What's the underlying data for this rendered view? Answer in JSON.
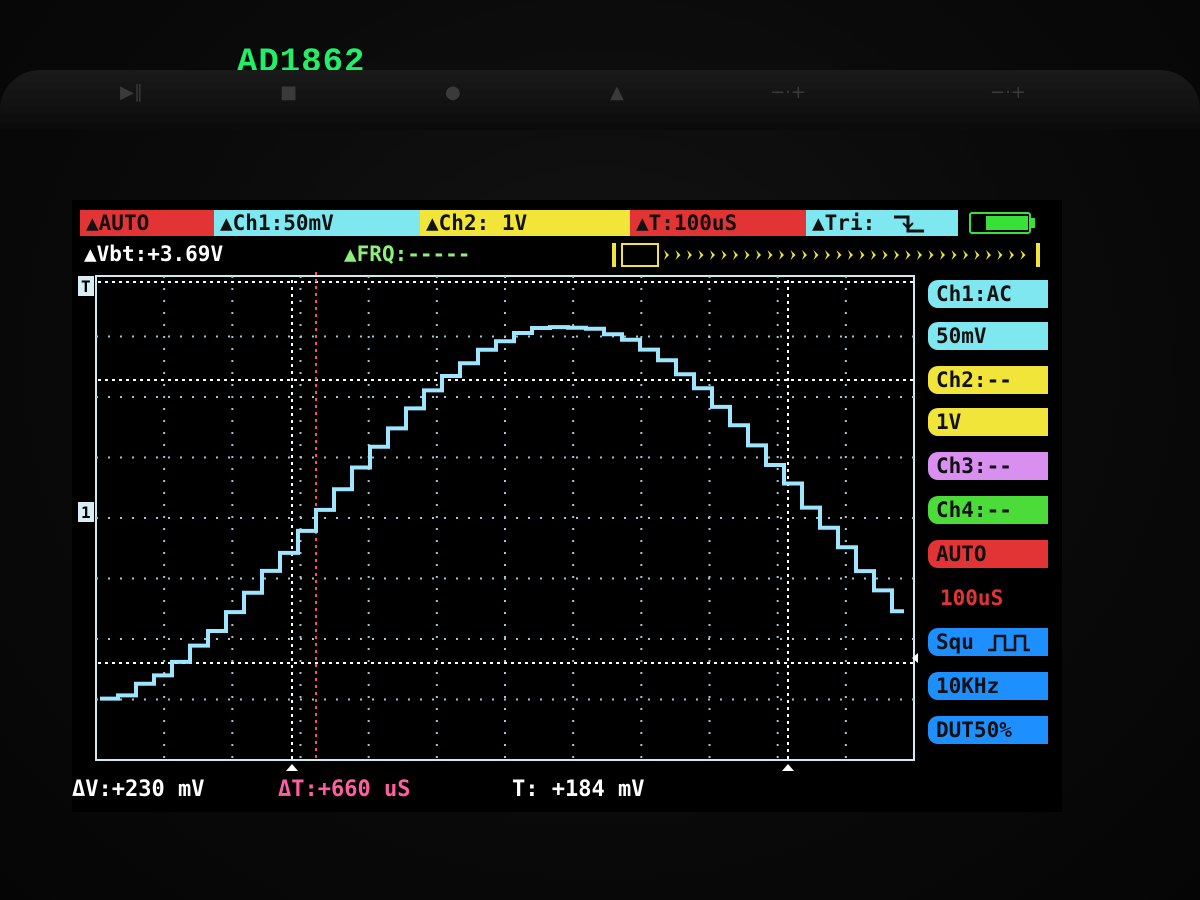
{
  "caption": "AD1862",
  "header": {
    "mode": "AUTO",
    "ch1": "Ch1:50mV",
    "ch2": "Ch2: 1V",
    "timebase": "T:100uS",
    "trigger": "Tri:"
  },
  "status": {
    "vbat": "Vbt:+3.69V",
    "frequency": "FRQ:-----"
  },
  "side_panel": {
    "ch1_coupling": "Ch1:AC",
    "ch1_scale": "50mV",
    "ch2": "Ch2:--",
    "ch2_scale": "1V",
    "ch3": "Ch3:--",
    "ch4": "Ch4:--",
    "mode": "AUTO",
    "timebase": "100uS",
    "wave": "Squ",
    "freq": "10KHz",
    "duty": "DUT50%"
  },
  "measurements": {
    "delta_v": "ΔV:+230 mV",
    "delta_t": "ΔT:+660 uS",
    "t_level": "T: +184 mV"
  },
  "markers": {
    "trigger_marker": "T",
    "ground_marker": "1"
  },
  "colors": {
    "auto": "#e23434",
    "ch1": "#7fe7f0",
    "ch2": "#f2e53a",
    "time": "#e23434",
    "trigger": "#7fe7f0",
    "ch3": "#d98ff0",
    "ch4": "#4cdc3a",
    "freq_box": "#1e8fff",
    "trace": "#9ee6ff",
    "battery": "#38e038"
  }
}
